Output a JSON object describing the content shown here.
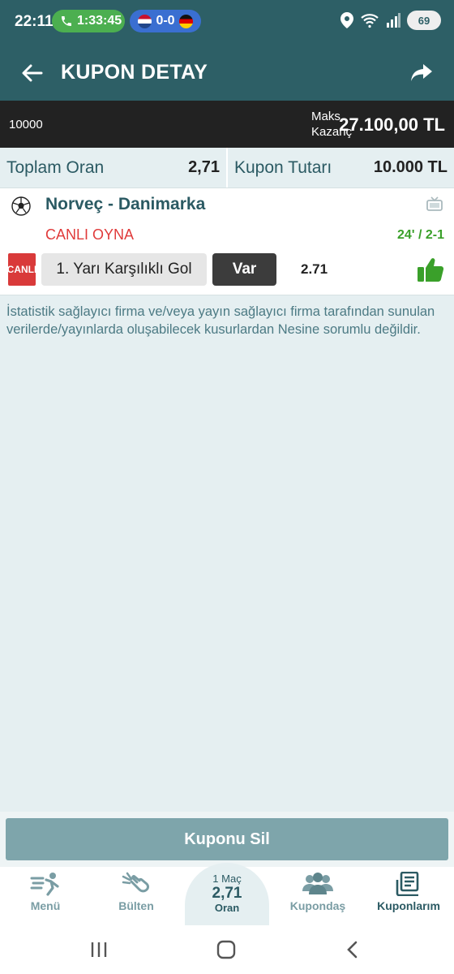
{
  "status_bar": {
    "time": "22:11",
    "call_timer": "1:33:45",
    "score": "0-0",
    "battery": "69"
  },
  "header": {
    "title": "KUPON DETAY"
  },
  "coupon": {
    "amount": "10000",
    "max_win_label": "Maks.\nKazanç",
    "max_win_value": "27.100,00 TL",
    "total_odds_label": "Toplam Oran",
    "total_odds_value": "2,71",
    "coupon_amount_label": "Kupon Tutarı",
    "coupon_amount_value": "10.000 TL"
  },
  "match": {
    "teams": "Norveç - Danimarka",
    "live_link": "CANLI OYNA",
    "live_status": "24' / 2-1",
    "badge": "CANLI",
    "bet_market": "1. Yarı Karşılıklı Gol",
    "bet_pick": "Var",
    "bet_odd": "2.71"
  },
  "disclaimer": "İstatistik sağlayıcı firma ve/veya yayın sağlayıcı firma tarafından sunulan verilerde/yayınlarda oluşabilecek kusurlardan Nesine sorumlu değildir.",
  "actions": {
    "delete_label": "Kuponu Sil"
  },
  "bottom_nav": {
    "menu": "Menü",
    "bulletin": "Bülten",
    "center_count": "1 Maç",
    "center_odds": "2,71",
    "center_label": "Oran",
    "kupondas": "Kupondaş",
    "my_coupons": "Kuponlarım"
  },
  "colors": {
    "primary": "#2d5f66",
    "live_red": "#d93a3a",
    "win_green": "#3aa02a",
    "button": "#7ea5ab"
  }
}
